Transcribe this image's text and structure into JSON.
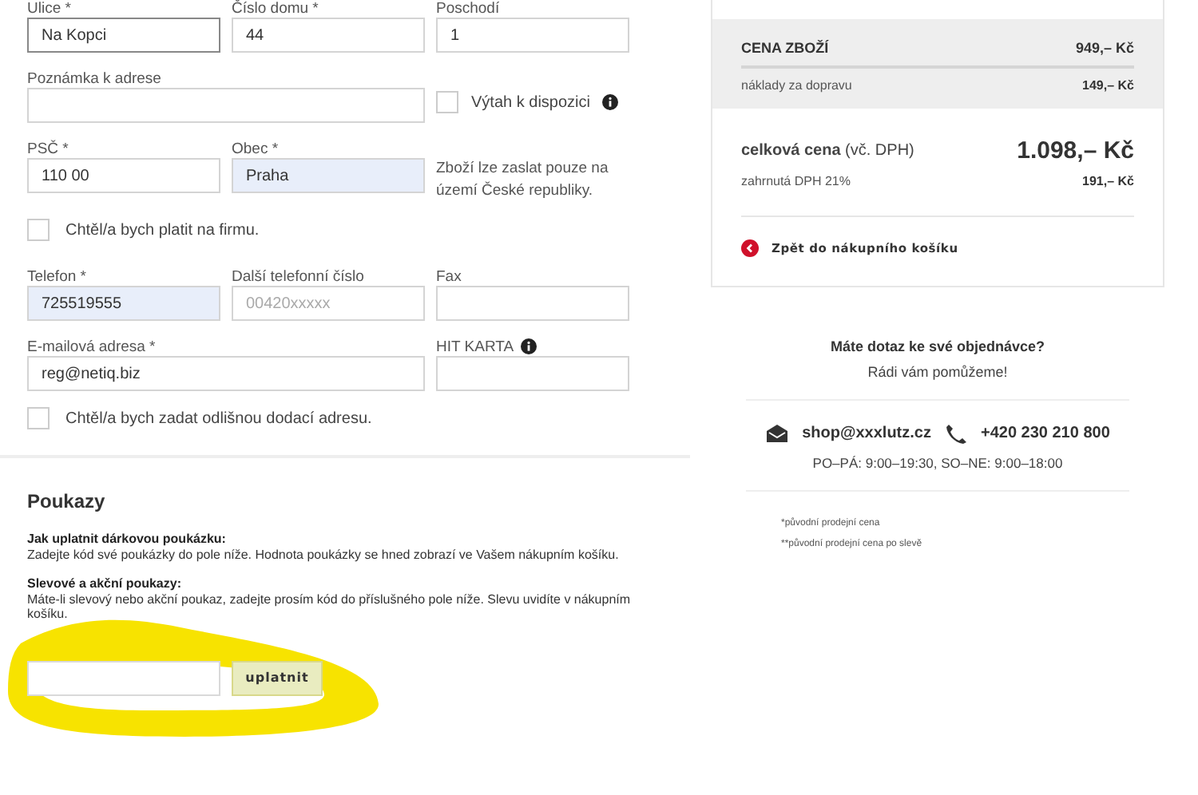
{
  "address": {
    "rows": [
      {
        "fields": [
          {
            "label": "Ulice *",
            "value": "Na Kopci",
            "highlighted": false,
            "focused": true
          },
          {
            "label": "Číslo domu *",
            "value": "44",
            "highlighted": false,
            "focused": false
          },
          {
            "label": "Poschodí",
            "value": "1",
            "highlighted": false,
            "focused": false
          }
        ]
      },
      {
        "fields": [
          {
            "label": "Poznámka k adrese",
            "highlighted": false,
            "focused": false
          }
        ],
        "checkbox": {
          "label": "Výtah k dispozici",
          "checked": false,
          "info": true
        }
      },
      {
        "fields": [
          {
            "label": "PSČ *",
            "value": "110 00",
            "highlighted": false,
            "focused": false
          },
          {
            "label": "Obec *",
            "value": "Praha",
            "highlighted": true,
            "focused": false
          }
        ],
        "note": "Zboží lze zaslat pouze na území České republiky."
      }
    ],
    "company_checkbox": {
      "label": "Chtěl/a bych platit na firmu.",
      "checked": false
    }
  },
  "contact": {
    "rows": [
      {
        "fields": [
          {
            "label": "Telefon *",
            "value": "725519555",
            "highlighted": true,
            "focused": false
          },
          {
            "label": "Další telefonní číslo",
            "placeholder": "00420xxxxx",
            "highlighted": false,
            "focused": false
          },
          {
            "label": "Fax",
            "highlighted": false,
            "focused": false
          }
        ]
      },
      {
        "fields": [
          {
            "label": "E-mailová adresa *",
            "value": "reg@netiq.biz",
            "highlighted": false,
            "focused": false
          },
          {
            "label": "HIT KARTA",
            "highlighted": false,
            "focused": false,
            "info": true
          }
        ]
      }
    ],
    "delivery_checkbox": {
      "label": "Chtěl/a bych zadat odlišnou dodací adresu.",
      "checked": false
    }
  },
  "vouchers": {
    "title": "Poukazy",
    "sections": [
      {
        "heading": "Jak uplatnit dárkovou poukázku:",
        "text": "Zadejte kód své poukázky do pole níže. Hodnota poukázky se hned zobrazí ve Vašem nákupním košíku."
      },
      {
        "heading": "Slevové a akční poukazy:",
        "text": "Máte-li slevový nebo akční poukaz, zadejte prosím kód do příslušného pole níže. Slevu uvidíte v nákupním košíku."
      }
    ],
    "button": "uplatnit"
  },
  "summary": {
    "goods_label": "CENA ZBOŽÍ",
    "goods_value": "949,– Kč",
    "shipping_label": "náklady za dopravu",
    "shipping_value": "149,– Kč",
    "total_label": "**celková cena** (vč. DPH)",
    "total_value": "1.098,– Kč",
    "vat_label": "zahrnutá DPH 21%",
    "vat_value": "191,– Kč",
    "back_link": "Zpět do nákupního košíku"
  },
  "help": {
    "title": "Máte dotaz ke své objednávce?",
    "subtitle": "Rádi vám pomůžeme!",
    "email": "shop@xxxlutz.cz",
    "phone": "+420 230 210 800",
    "hours": "PO–PÁ: 9:00–19:30, SO–NE: 9:00–18:00",
    "footnotes": [
      "*původní prodejní cena",
      "**původní prodejní cena po slevě"
    ]
  }
}
